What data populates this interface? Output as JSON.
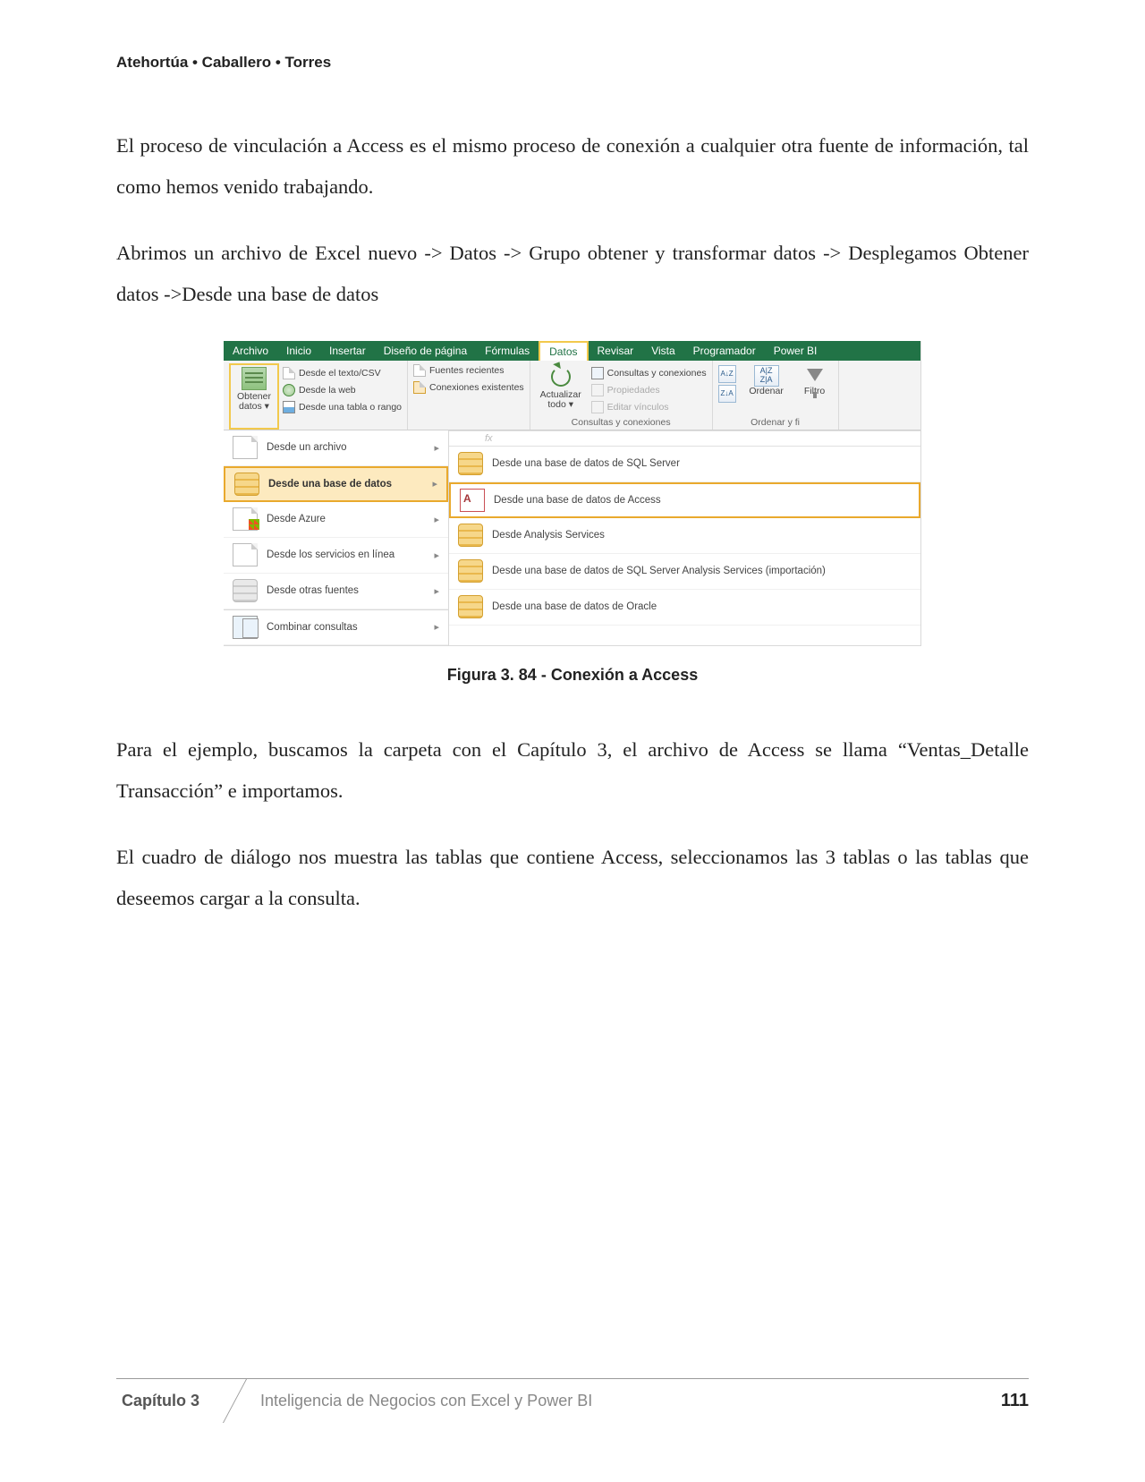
{
  "authors": "Atehortúa • Caballero • Torres",
  "para1": "El proceso de vinculación a Access es el mismo proceso de conexión a cualquier otra fuente de información, tal como hemos venido trabajando.",
  "para2": "Abrimos un archivo de Excel nuevo -> Datos -> Grupo obtener y transformar datos -> Desplegamos Obtener datos ->Desde una base de datos",
  "excel": {
    "tabs": {
      "archivo": "Archivo",
      "inicio": "Inicio",
      "insertar": "Insertar",
      "diseno": "Diseño de página",
      "formulas": "Fórmulas",
      "datos": "Datos",
      "revisar": "Revisar",
      "vista": "Vista",
      "programador": "Programador",
      "powerbi": "Power BI"
    },
    "ribbon": {
      "obtener_datos": "Obtener\ndatos ▾",
      "desde_csv": "Desde el texto/CSV",
      "desde_web": "Desde la web",
      "desde_tabla": "Desde una tabla o rango",
      "fuentes_recientes": "Fuentes recientes",
      "conexiones_existentes": "Conexiones existentes",
      "actualizar_todo": "Actualizar\ntodo ▾",
      "consultas_conexiones": "Consultas y conexiones",
      "propiedades": "Propiedades",
      "editar_vinculos": "Editar vínculos",
      "group_consultas": "Consultas y conexiones",
      "sort_az": "A↓Z",
      "sort_za": "Z↓A",
      "ordenar": "Ordenar",
      "filtro": "Filtro",
      "ordenar_filtrar": "Ordenar y fi"
    },
    "formula_fx": "fx",
    "menu_left": {
      "archivo": "Desde un archivo",
      "base_datos": "Desde una base de datos",
      "azure": "Desde Azure",
      "servicios": "Desde los servicios en línea",
      "otras": "Desde otras fuentes",
      "combinar": "Combinar consultas"
    },
    "menu_right": {
      "sql": "Desde una base de datos de SQL Server",
      "access": "Desde una base de datos de Access",
      "analysis": "Desde Analysis Services",
      "ssas_import": "Desde una base de datos de SQL Server Analysis Services (importación)",
      "oracle": "Desde una base de datos de Oracle"
    }
  },
  "caption": "Figura 3. 84 - Conexión a Access",
  "para3": "Para el ejemplo, buscamos la carpeta con el Capítulo 3, el archivo de Access se llama “Ventas_Detalle Transacción” e importamos.",
  "para4": "El cuadro de diálogo nos muestra las tablas que contiene Access, seleccionamos las 3 tablas o las tablas que deseemos cargar a la consulta.",
  "footer": {
    "chapter": "Capítulo 3",
    "title": "Inteligencia de Negocios con Excel y Power BI",
    "page": "111"
  }
}
